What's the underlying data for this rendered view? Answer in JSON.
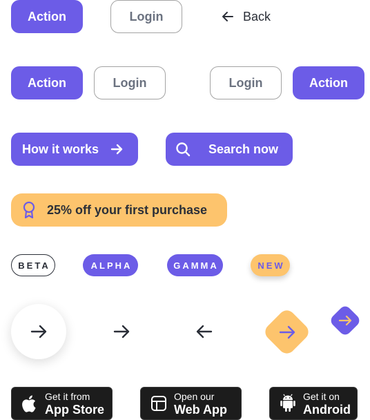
{
  "row1": {
    "action_label": "Action",
    "login_label": "Login",
    "back_label": "Back"
  },
  "row2": {
    "action_label": "Action",
    "login_label": "Login",
    "login2_label": "Login",
    "action2_label": "Action"
  },
  "row3": {
    "how_label": "How it works",
    "search_label": "Search now"
  },
  "promo": {
    "label": "25% off your first purchase"
  },
  "badges": {
    "beta": "BETA",
    "alpha": "ALPHA",
    "gamma": "GAMMA",
    "new": "NEW"
  },
  "stores": {
    "apple_small": "Get it from",
    "apple_big": "App Store",
    "web_small": "Open our",
    "web_big": "Web App",
    "android_small": "Get it on",
    "android_big": "Android"
  },
  "colors": {
    "primary": "#6c5ce7",
    "accent": "#fdc46d",
    "dark": "#2b2f38",
    "store_bg": "#1c1c1c"
  }
}
